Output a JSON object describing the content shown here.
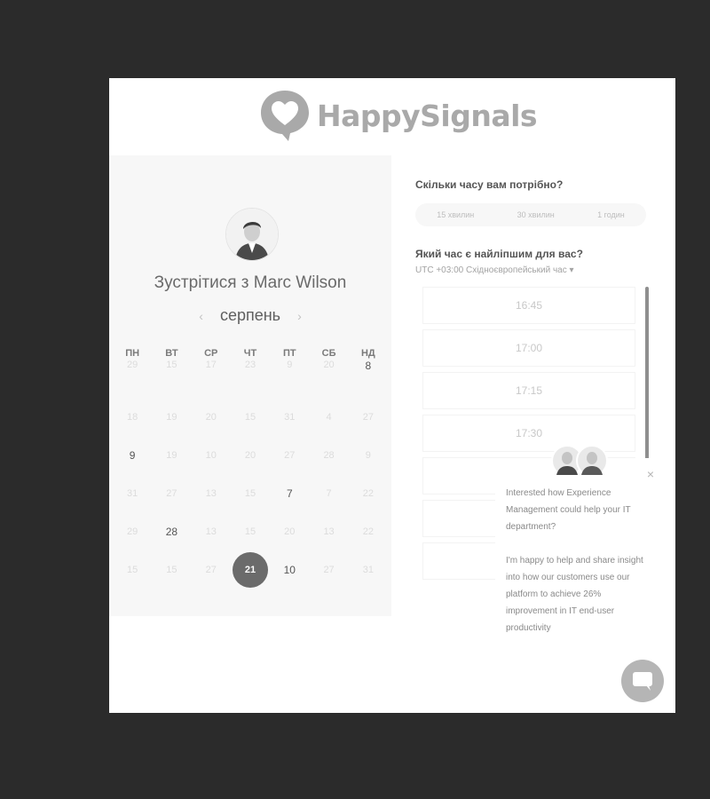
{
  "logo": {
    "text": "HappySignals"
  },
  "meeting": {
    "title": "Зустрітися з Marc Wilson"
  },
  "calendar": {
    "month": "серпень",
    "prev_arrow": "‹",
    "next_arrow": "›",
    "weekdays": [
      "ПН",
      "ВТ",
      "СР",
      "ЧТ",
      "ПТ",
      "СБ",
      "НД"
    ],
    "weeks": [
      [
        "29",
        "15",
        "17",
        "23",
        "9",
        "20",
        "8"
      ],
      [
        "18",
        "19",
        "20",
        "15",
        "31",
        "4",
        "27"
      ],
      [
        "9",
        "19",
        "10",
        "20",
        "27",
        "28",
        "9"
      ],
      [
        "31",
        "27",
        "13",
        "15",
        "7",
        "7",
        "22"
      ],
      [
        "29",
        "28",
        "13",
        "15",
        "20",
        "13",
        "22"
      ],
      [
        "15",
        "15",
        "27",
        "21",
        "10",
        "27",
        "31"
      ]
    ],
    "available": [
      "0-6",
      "2-0",
      "3-4",
      "4-1",
      "5-4"
    ],
    "selected": "5-3"
  },
  "duration": {
    "question": "Скільки часу вам потрібно?",
    "options": [
      "15 хвилин",
      "30 хвилин",
      "1 годин"
    ]
  },
  "timeslots": {
    "question": "Який час є найліпшим для вас?",
    "timezone": "UTC +03:00 Східноєвропейський час",
    "times": [
      "16:45",
      "17:00",
      "17:15",
      "17:30",
      "",
      "",
      ""
    ]
  },
  "popup": {
    "text1": "Interested how Experience Management could help your IT department?",
    "text2": "I'm happy to help and share insight into how our customers use our platform to achieve 26% improvement in IT end-user productivity",
    "close": "×"
  },
  "colors": {
    "selected_day": "#6b6b6b",
    "logo": "#a9a9a9"
  }
}
